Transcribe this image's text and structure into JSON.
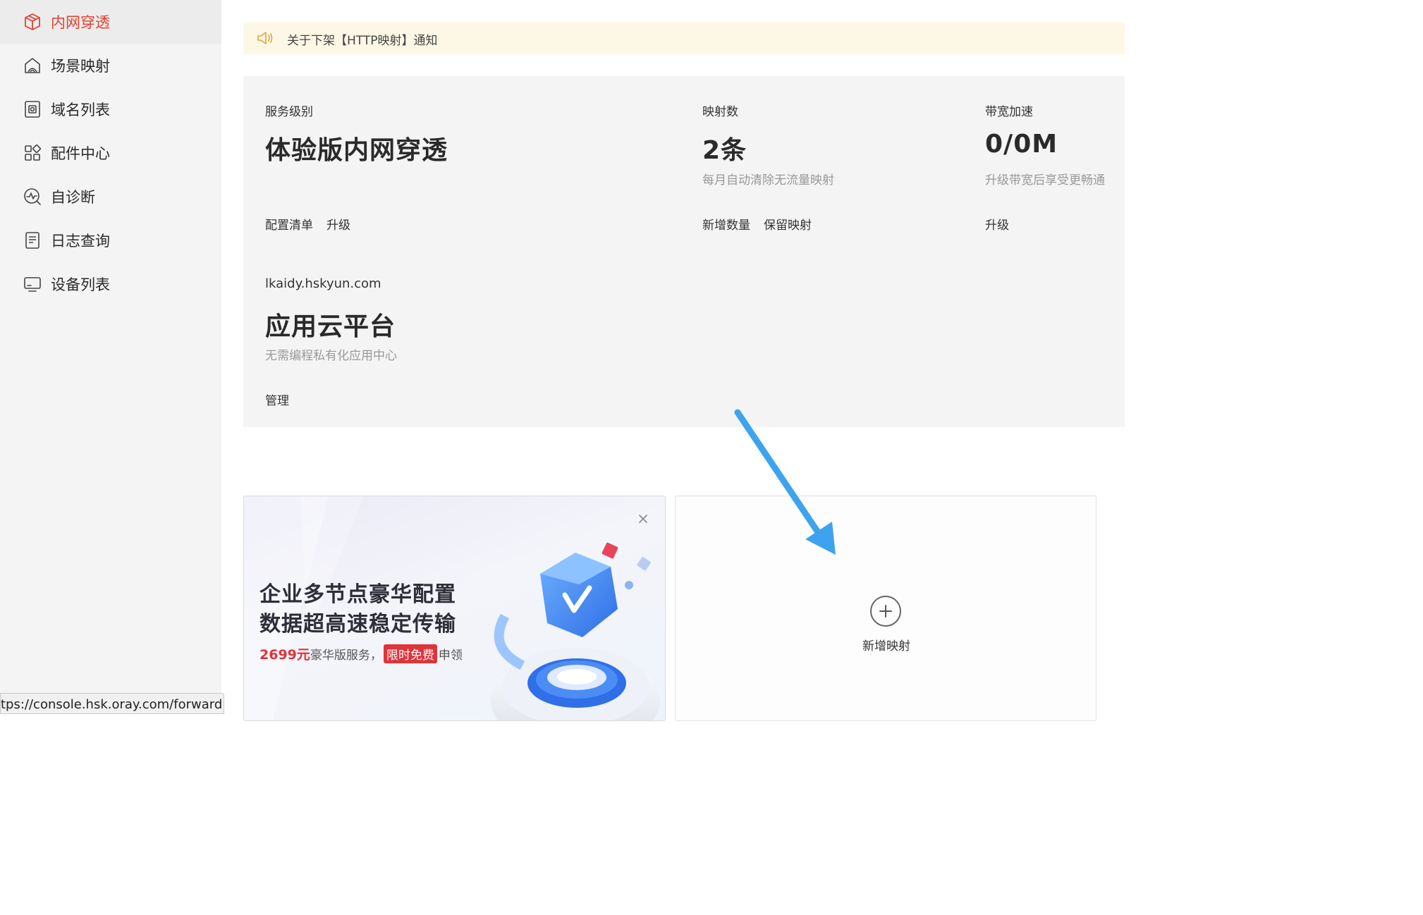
{
  "sidebar": {
    "items": [
      {
        "label": "内网穿透",
        "icon": "cube-icon",
        "active": true
      },
      {
        "label": "场景映射",
        "icon": "house-icon",
        "active": false
      },
      {
        "label": "域名列表",
        "icon": "domain-icon",
        "active": false
      },
      {
        "label": "配件中心",
        "icon": "grid-icon",
        "active": false
      },
      {
        "label": "自诊断",
        "icon": "diagnose-icon",
        "active": false
      },
      {
        "label": "日志查询",
        "icon": "log-icon",
        "active": false
      },
      {
        "label": "设备列表",
        "icon": "monitor-icon",
        "active": false
      }
    ]
  },
  "status_bar": {
    "url": "tps://console.hsk.oray.com/forward"
  },
  "notice": {
    "text": "关于下架【HTTP映射】通知",
    "icon": "speaker-icon"
  },
  "stats": {
    "service": {
      "label": "服务级别",
      "value": "体验版内网穿透",
      "link1": "配置清单",
      "link2": "升级"
    },
    "mappings": {
      "label": "映射数",
      "value": "2条",
      "sub": "每月自动清除无流量映射",
      "link1": "新增数量",
      "link2": "保留映射"
    },
    "bandwidth": {
      "label": "带宽加速",
      "value": "0/0M",
      "sub": "升级带宽后享受更畅通",
      "link1": "升级"
    },
    "app": {
      "domain": "lkaidy.hskyun.com",
      "value": "应用云平台",
      "sub": "无需编程私有化应用中心",
      "link1": "管理"
    }
  },
  "promo": {
    "title1": "企业多节点豪华配置",
    "title2": "数据超高速稳定传输",
    "price": "2699元",
    "mid": "豪华版服务，",
    "badge": "限时免费",
    "end": "申领"
  },
  "add_card": {
    "label": "新增映射"
  },
  "colors": {
    "accent": "#e2412f",
    "arrow": "#3ea3ee",
    "notice_bg": "#fdf8e6",
    "sidebar_bg": "#f4f4f4"
  }
}
